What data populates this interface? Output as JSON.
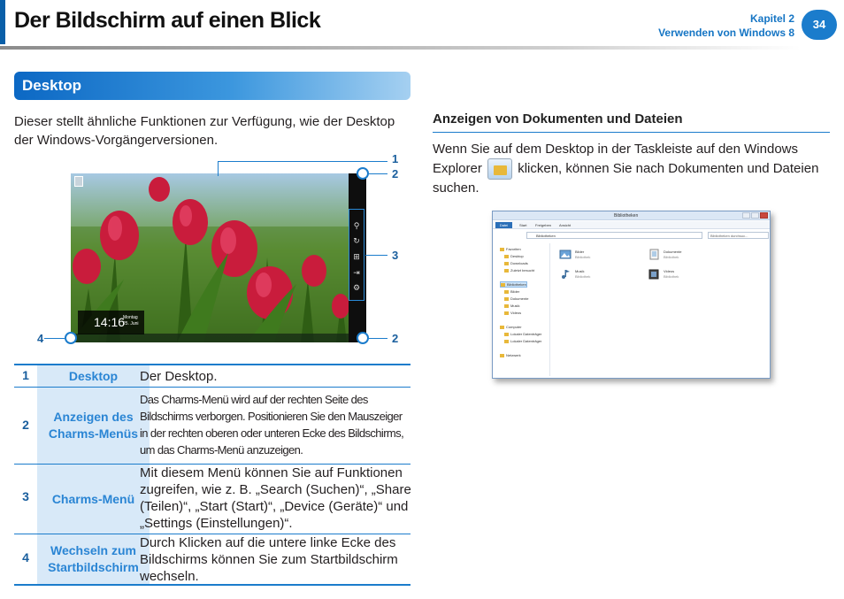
{
  "header": {
    "title": "Der Bildschirm auf einen Blick",
    "chapter": "Kapitel 2",
    "chapter_title": "Verwenden von Windows 8",
    "page_number": "34"
  },
  "section": {
    "title": "Desktop",
    "intro": "Dieser stellt ähnliche Funktionen zur Verfügung, wie der Desktop der Windows-Vorgängerversionen."
  },
  "screenshot": {
    "time": "14:16",
    "day": "Montag",
    "date": "25. Juni",
    "callouts": [
      "1",
      "2",
      "3",
      "4",
      "2"
    ]
  },
  "table": {
    "rows": [
      {
        "num": "1",
        "label": "Desktop",
        "desc": "Der Desktop."
      },
      {
        "num": "2",
        "label": "Anzeigen des Charms-Menüs",
        "desc": "Das Charms-Menü wird auf der rechten Seite des Bildschirms verborgen. Positionieren Sie den Mauszeiger in der rechten oberen oder unteren Ecke des Bildschirms, um das Charms-Menü anzuzeigen."
      },
      {
        "num": "3",
        "label": "Charms-Menü",
        "desc": "Mit diesem Menü können Sie auf Funktionen zugreifen, wie z. B. „Search (Suchen)“, „Share (Teilen)“, „Start (Start)“, „Device (Geräte)“ und „Settings (Einstellungen)“."
      },
      {
        "num": "4",
        "label": "Wechseln zum Startbildschirm",
        "desc": "Durch Klicken auf die untere linke Ecke des Bildschirms können Sie zum Startbildschirm wechseln."
      }
    ]
  },
  "right": {
    "heading": "Anzeigen von Dokumenten und Dateien",
    "text_before": "Wenn Sie auf dem Desktop in der Taskleiste auf den Windows Explorer",
    "text_after": "klicken, können Sie nach Dokumenten und Dateien suchen."
  },
  "explorer": {
    "title": "Bibliotheken",
    "file_tab": "Datei",
    "tabs": [
      "Start",
      "Freigeben",
      "Ansicht"
    ],
    "address": "Bibliotheken",
    "search_placeholder": "Bibliotheken durchsuc...",
    "nav": [
      "Favoriten",
      "Desktop",
      "Downloads",
      "Zuletzt besucht",
      "Bibliotheken",
      "Bilder",
      "Dokumente",
      "Musik",
      "Videos",
      "Computer",
      "Lokaler Datenträger",
      "Lokaler Datenträger",
      "Netzwerk"
    ],
    "libraries": [
      {
        "name": "Bilder",
        "sub": "Bibliothek"
      },
      {
        "name": "Dokumente",
        "sub": "Bibliothek"
      },
      {
        "name": "Musik",
        "sub": "Bibliothek"
      },
      {
        "name": "Videos",
        "sub": "Bibliothek"
      }
    ]
  }
}
